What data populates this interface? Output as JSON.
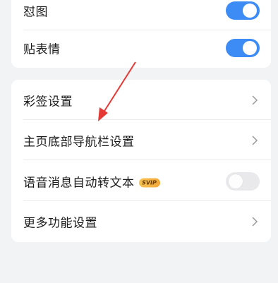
{
  "card1": {
    "rows": [
      {
        "label": "怼图",
        "toggle": "on"
      },
      {
        "label": "贴表情",
        "toggle": "on"
      }
    ]
  },
  "card2": {
    "rows": [
      {
        "label": "彩签设置",
        "icon": "chevron-right-icon"
      },
      {
        "label": "主页底部导航栏设置",
        "icon": "chevron-right-icon"
      },
      {
        "label": "语音消息自动转文本",
        "badge": "SVIP",
        "toggle": "off"
      },
      {
        "label": "更多功能设置",
        "icon": "chevron-right-icon"
      }
    ]
  },
  "colors": {
    "toggle_on": "#3d8cf5",
    "toggle_off": "#e9e9eb",
    "annotation_arrow": "#e53935",
    "background": "#f2f3f5"
  }
}
